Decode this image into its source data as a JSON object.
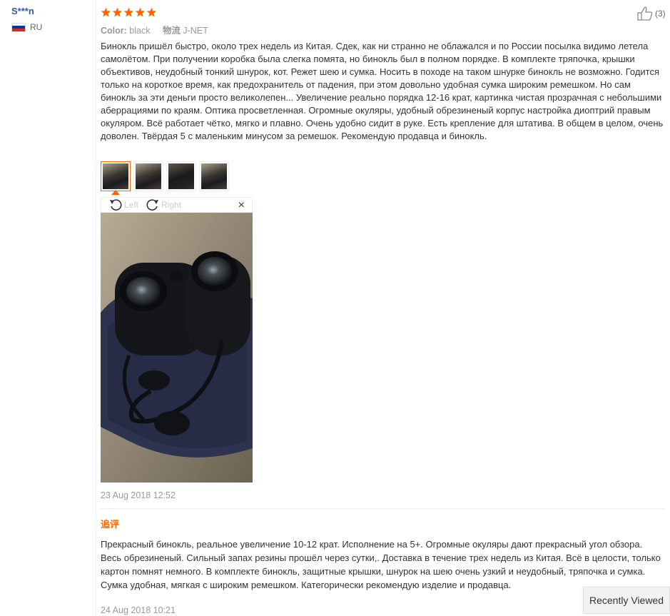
{
  "user": {
    "name": "S***n",
    "country_code": "RU",
    "flag_colors": [
      "#ffffff",
      "#0039a6",
      "#d52b1e"
    ]
  },
  "review": {
    "rating": 5,
    "star_color": "#f60",
    "color_label": "Color:",
    "color_value": "black",
    "shipping_label": "物流",
    "shipping_value": "J-NET",
    "helpful_count": "(3)",
    "text": "Бинокль пришёл быстро, около трех недель из Китая. Сдек, как ни странно не облажался и по России посылка видимо летела самолётом. При получении коробка была слегка помята, но бинокль был в полном порядке. В комплекте тряпочка, крышки объективов, неудобный тонкий шнурок, кот. Режет шею и сумка. Носить в походе на таком шнурке бинокль не возможно. Годится только на короткое время, как предохранитель от падения, при этом довольно удобная сумка широким ремешком. Но сам бинокль за эти деньги просто великолепен... Увеличение реально порядка 12-16 крат, картинка чистая прозрачная с небольшими аберрациями по краям. Оптика просветленная. Огромные окуляры, удобный обрезиненый корпус настройка диоптрий правым окуляром. Всё работает чётко, мягко и плавно. Очень удобно сидит в руке. Есть крепление для штатива. В общем в целом, очень доволен. Твёрдая 5 с маленьким минусом за ремешок. Рекомендую продавца и бинокль.",
    "thumbnails_count": 4,
    "viewer": {
      "rotate_left": "Left",
      "rotate_right": "Right",
      "close": "×"
    },
    "date": "23 Aug 2018 12:52"
  },
  "followup": {
    "label": "追评",
    "text": "Прекрасный бинокль, реальное увеличение 10-12 крат. Исполнение на 5+. Огромные окуляры дают прекрасный угол обзора. Весь обрезиненый. Сильный запах резины прошёл через сутки,. Доставка в течение трех недель из Китая. Всё в целости, только картон помнят немного. В комплекте бинокль, защитные крышки, шнурок на шею очень узкий и неудобный, тряпочка и сумка. Сумка удобная, мягкая с широким ремешком. Категорически рекомендую изделие и продавца.",
    "date": "24 Aug 2018 10:21"
  },
  "recently_viewed": "Recently Viewed"
}
